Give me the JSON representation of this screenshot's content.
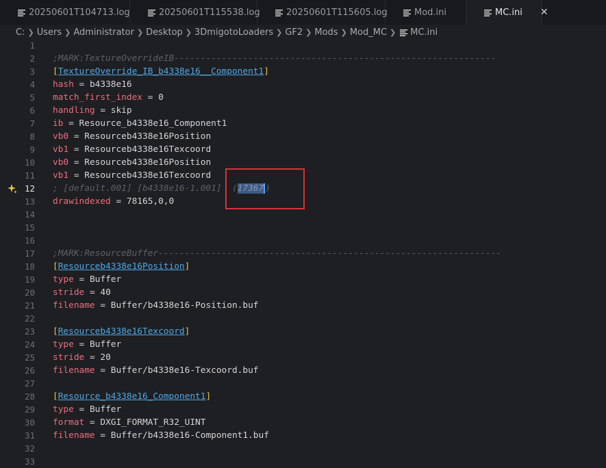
{
  "tabs": [
    {
      "label": "20250601T104713.log",
      "active": false
    },
    {
      "label": "20250601T115538.log",
      "active": false
    },
    {
      "label": "20250601T115605.log",
      "active": false
    },
    {
      "label": "Mod.ini",
      "active": false
    },
    {
      "label": "MC.ini",
      "active": true
    }
  ],
  "tab_close": "✕",
  "breadcrumb": [
    "C:",
    "Users",
    "Administrator",
    "Desktop",
    "3DmigotoLoaders",
    "GF2",
    "Mods",
    "Mod_MC",
    "MC.ini"
  ],
  "colors": {
    "accent": "#4fa8e8",
    "key": "#ee6c7e",
    "bracket": "#e9c846",
    "annotation": "#d8323a"
  },
  "editor": {
    "active_line": 12,
    "lines": [
      {
        "n": "1",
        "tokens": []
      },
      {
        "n": "2",
        "tokens": [
          {
            "t": ";MARK:TextureOverrideIB-------------------------------------------------------------",
            "c": "c-comment"
          }
        ]
      },
      {
        "n": "3",
        "tokens": [
          {
            "t": "[",
            "c": "c-bracket"
          },
          {
            "t": "TextureOverride_IB_b4338e16__Component1",
            "c": "c-section"
          },
          {
            "t": "]",
            "c": "c-bracket"
          }
        ]
      },
      {
        "n": "4",
        "tokens": [
          {
            "t": "hash",
            "c": "c-key"
          },
          {
            "t": " = ",
            "c": "c-op"
          },
          {
            "t": "b4338e16",
            "c": "c-val"
          }
        ]
      },
      {
        "n": "5",
        "tokens": [
          {
            "t": "match_first_index",
            "c": "c-key"
          },
          {
            "t": " = ",
            "c": "c-op"
          },
          {
            "t": "0",
            "c": "c-val"
          }
        ]
      },
      {
        "n": "6",
        "tokens": [
          {
            "t": "handling",
            "c": "c-key"
          },
          {
            "t": " = ",
            "c": "c-op"
          },
          {
            "t": "skip",
            "c": "c-val"
          }
        ]
      },
      {
        "n": "7",
        "tokens": [
          {
            "t": "ib",
            "c": "c-key"
          },
          {
            "t": " = ",
            "c": "c-op"
          },
          {
            "t": "Resource_b4338e16_Component1",
            "c": "c-val"
          }
        ]
      },
      {
        "n": "8",
        "tokens": [
          {
            "t": "vb0",
            "c": "c-key"
          },
          {
            "t": " = ",
            "c": "c-op"
          },
          {
            "t": "Resourceb4338e16Position",
            "c": "c-val"
          }
        ]
      },
      {
        "n": "9",
        "tokens": [
          {
            "t": "vb1",
            "c": "c-key"
          },
          {
            "t": " = ",
            "c": "c-op"
          },
          {
            "t": "Resourceb4338e16Texcoord",
            "c": "c-val"
          }
        ]
      },
      {
        "n": "10",
        "tokens": [
          {
            "t": "vb0",
            "c": "c-key"
          },
          {
            "t": " = ",
            "c": "c-op"
          },
          {
            "t": "Resourceb4338e16Position",
            "c": "c-val"
          }
        ]
      },
      {
        "n": "11",
        "tokens": [
          {
            "t": "vb1",
            "c": "c-key"
          },
          {
            "t": " = ",
            "c": "c-op"
          },
          {
            "t": "Resourceb4338e16Texcoord",
            "c": "c-val"
          }
        ]
      },
      {
        "n": "12",
        "tokens": [
          {
            "t": "; [default.001] [b4338e16-1.001]  (",
            "c": "c-gray"
          },
          {
            "t": "17367",
            "c": "c-hl"
          },
          {
            "t": "|cursor|",
            "c": "cursor"
          },
          {
            "t": ")",
            "c": "c-gray"
          }
        ]
      },
      {
        "n": "13",
        "tokens": [
          {
            "t": "drawindexed",
            "c": "c-key"
          },
          {
            "t": " = ",
            "c": "c-op"
          },
          {
            "t": "78165,0,0",
            "c": "c-val"
          }
        ]
      },
      {
        "n": "14",
        "tokens": []
      },
      {
        "n": "15",
        "tokens": []
      },
      {
        "n": "16",
        "tokens": []
      },
      {
        "n": "17",
        "tokens": [
          {
            "t": ";MARK:ResourceBuffer-----------------------------------------------------------------",
            "c": "c-comment"
          }
        ]
      },
      {
        "n": "18",
        "tokens": [
          {
            "t": "[",
            "c": "c-bracket"
          },
          {
            "t": "Resourceb4338e16Position",
            "c": "c-section"
          },
          {
            "t": "]",
            "c": "c-bracket"
          }
        ]
      },
      {
        "n": "19",
        "tokens": [
          {
            "t": "type",
            "c": "c-key"
          },
          {
            "t": " = ",
            "c": "c-op"
          },
          {
            "t": "Buffer",
            "c": "c-val"
          }
        ]
      },
      {
        "n": "20",
        "tokens": [
          {
            "t": "stride",
            "c": "c-key"
          },
          {
            "t": " = ",
            "c": "c-op"
          },
          {
            "t": "40",
            "c": "c-val"
          }
        ]
      },
      {
        "n": "21",
        "tokens": [
          {
            "t": "filename",
            "c": "c-key"
          },
          {
            "t": " = ",
            "c": "c-op"
          },
          {
            "t": "Buffer/b4338e16-Position.buf",
            "c": "c-val"
          }
        ]
      },
      {
        "n": "22",
        "tokens": []
      },
      {
        "n": "23",
        "tokens": [
          {
            "t": "[",
            "c": "c-bracket"
          },
          {
            "t": "Resourceb4338e16Texcoord",
            "c": "c-section"
          },
          {
            "t": "]",
            "c": "c-bracket"
          }
        ]
      },
      {
        "n": "24",
        "tokens": [
          {
            "t": "type",
            "c": "c-key"
          },
          {
            "t": " = ",
            "c": "c-op"
          },
          {
            "t": "Buffer",
            "c": "c-val"
          }
        ]
      },
      {
        "n": "25",
        "tokens": [
          {
            "t": "stride",
            "c": "c-key"
          },
          {
            "t": " = ",
            "c": "c-op"
          },
          {
            "t": "20",
            "c": "c-val"
          }
        ]
      },
      {
        "n": "26",
        "tokens": [
          {
            "t": "filename",
            "c": "c-key"
          },
          {
            "t": " = ",
            "c": "c-op"
          },
          {
            "t": "Buffer/b4338e16-Texcoord.buf",
            "c": "c-val"
          }
        ]
      },
      {
        "n": "27",
        "tokens": []
      },
      {
        "n": "28",
        "tokens": [
          {
            "t": "[",
            "c": "c-bracket"
          },
          {
            "t": "Resource_b4338e16_Component1",
            "c": "c-section"
          },
          {
            "t": "]",
            "c": "c-bracket"
          }
        ]
      },
      {
        "n": "29",
        "tokens": [
          {
            "t": "type",
            "c": "c-key"
          },
          {
            "t": " = ",
            "c": "c-op"
          },
          {
            "t": "Buffer",
            "c": "c-val"
          }
        ]
      },
      {
        "n": "30",
        "tokens": [
          {
            "t": "format",
            "c": "c-key"
          },
          {
            "t": " = ",
            "c": "c-op"
          },
          {
            "t": "DXGI_FORMAT_R32_UINT",
            "c": "c-val"
          }
        ]
      },
      {
        "n": "31",
        "tokens": [
          {
            "t": "filename",
            "c": "c-key"
          },
          {
            "t": " = ",
            "c": "c-op"
          },
          {
            "t": "Buffer/b4338e16-Component1.buf",
            "c": "c-val"
          }
        ]
      },
      {
        "n": "32",
        "tokens": []
      },
      {
        "n": "33",
        "tokens": []
      }
    ]
  }
}
